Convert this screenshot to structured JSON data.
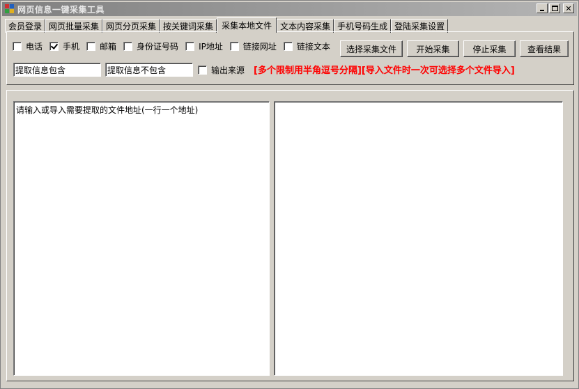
{
  "window": {
    "title": "网页信息一键采集工具"
  },
  "tabs": [
    {
      "label": "会员登录"
    },
    {
      "label": "网页批量采集"
    },
    {
      "label": "网页分页采集"
    },
    {
      "label": "按关键词采集"
    },
    {
      "label": "采集本地文件",
      "active": true
    },
    {
      "label": "文本内容采集"
    },
    {
      "label": "手机号码生成"
    },
    {
      "label": "登陆采集设置"
    }
  ],
  "options": {
    "phone": {
      "label": "电话",
      "checked": false
    },
    "mobile": {
      "label": "手机",
      "checked": true
    },
    "email": {
      "label": "邮箱",
      "checked": false
    },
    "id_number": {
      "label": "身份证号码",
      "checked": false
    },
    "ip": {
      "label": "IP地址",
      "checked": false
    },
    "link_url": {
      "label": "链接网址",
      "checked": false
    },
    "link_text": {
      "label": "链接文本",
      "checked": false
    },
    "output_source": {
      "label": "输出来源",
      "checked": false
    }
  },
  "buttons": {
    "select_file": "选择采集文件",
    "start": "开始采集",
    "stop": "停止采集",
    "view_results": "查看结果"
  },
  "filters": {
    "include_value": "提取信息包含",
    "exclude_value": "提取信息不包含"
  },
  "notice": "[多个限制用半角逗号分隔][导入文件时一次可选择多个文件导入]",
  "input_area": {
    "placeholder": "请输入或导入需要提取的文件地址(一行一个地址)"
  },
  "result_area": {
    "value": ""
  },
  "colors": {
    "face": "#d4d0c8",
    "notice": "#ff0000"
  }
}
